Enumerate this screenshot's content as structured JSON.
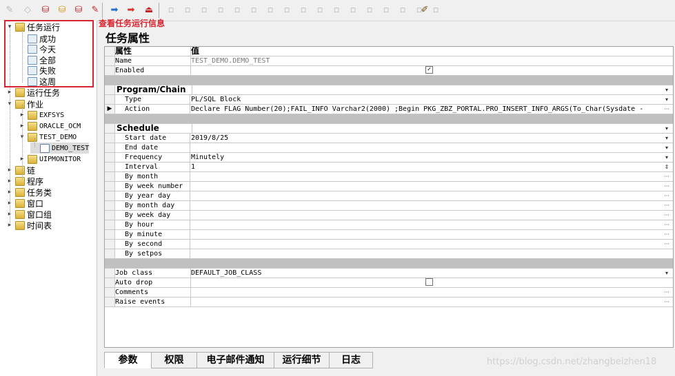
{
  "annotation": "查看任务运行信息",
  "panel_title": "任务属性",
  "tree": {
    "items": [
      {
        "label": "任务运行",
        "level": 0,
        "state": "open",
        "icon": "folder"
      },
      {
        "label": "成功",
        "level": 1,
        "state": "leaf",
        "icon": "page"
      },
      {
        "label": "今天",
        "level": 1,
        "state": "leaf",
        "icon": "page"
      },
      {
        "label": "全部",
        "level": 1,
        "state": "leaf",
        "icon": "page"
      },
      {
        "label": "失败",
        "level": 1,
        "state": "leaf",
        "icon": "page"
      },
      {
        "label": "这周",
        "level": 1,
        "state": "leaf",
        "icon": "page"
      },
      {
        "label": "运行任务",
        "level": 0,
        "state": "closed",
        "icon": "folder"
      },
      {
        "label": "作业",
        "level": 0,
        "state": "open",
        "icon": "folder"
      },
      {
        "label": "EXFSYS",
        "level": 1,
        "state": "closed",
        "icon": "folder"
      },
      {
        "label": "ORACLE_OCM",
        "level": 1,
        "state": "closed",
        "icon": "folder"
      },
      {
        "label": "TEST_DEMO",
        "level": 1,
        "state": "open",
        "icon": "folder"
      },
      {
        "label": "DEMO_TEST",
        "level": 2,
        "state": "leaf",
        "icon": "job",
        "selected": true
      },
      {
        "label": "UIPMONITOR",
        "level": 1,
        "state": "closed",
        "icon": "folder"
      },
      {
        "label": "链",
        "level": 0,
        "state": "closed",
        "icon": "folder"
      },
      {
        "label": "程序",
        "level": 0,
        "state": "closed",
        "icon": "folder"
      },
      {
        "label": "任务类",
        "level": 0,
        "state": "closed",
        "icon": "folder"
      },
      {
        "label": "窗口",
        "level": 0,
        "state": "closed",
        "icon": "folder"
      },
      {
        "label": "窗口组",
        "level": 0,
        "state": "closed",
        "icon": "folder"
      },
      {
        "label": "时间表",
        "level": 0,
        "state": "closed",
        "icon": "folder"
      }
    ]
  },
  "grid": {
    "col_property": "属性",
    "col_value": "值",
    "rows": [
      {
        "type": "row",
        "property": "Name",
        "value": "TEST_DEMO.DEMO_TEST",
        "value_gray": true
      },
      {
        "type": "row",
        "property": "Enabled",
        "checkbox": true,
        "checked": true
      },
      {
        "type": "group"
      },
      {
        "type": "section",
        "property": "Program/Chain",
        "button": "dropdown"
      },
      {
        "type": "row",
        "property": "Type",
        "value": "PL/SQL Block",
        "button": "dropdown",
        "indent": true
      },
      {
        "type": "row",
        "property": "Action",
        "value": "Declare  FLAG Number(20);FAIL_INFO   Varchar2(2000) ;Begin PKG_ZBZ_PORTAL.PRO_INSERT_INFO_ARGS(To_Char(Sysdate -",
        "button": "ellipsis",
        "indent": true,
        "current": true
      },
      {
        "type": "group"
      },
      {
        "type": "section",
        "property": "Schedule",
        "button": "dropdown"
      },
      {
        "type": "row",
        "property": "Start date",
        "value": "2019/8/25",
        "button": "dropdown",
        "indent": true
      },
      {
        "type": "row",
        "property": "End date",
        "value": "",
        "button": "dropdown",
        "indent": true
      },
      {
        "type": "row",
        "property": "Frequency",
        "value": "Minutely",
        "button": "dropdown",
        "indent": true
      },
      {
        "type": "row",
        "property": "Interval",
        "value": "1",
        "button": "spin",
        "indent": true
      },
      {
        "type": "row",
        "property": "By month",
        "value": "",
        "button": "ellipsis",
        "indent": true
      },
      {
        "type": "row",
        "property": "By week number",
        "value": "",
        "button": "ellipsis",
        "indent": true
      },
      {
        "type": "row",
        "property": "By year day",
        "value": "",
        "button": "ellipsis",
        "indent": true
      },
      {
        "type": "row",
        "property": "By month day",
        "value": "",
        "button": "ellipsis",
        "indent": true
      },
      {
        "type": "row",
        "property": "By week day",
        "value": "",
        "button": "ellipsis",
        "indent": true
      },
      {
        "type": "row",
        "property": "By hour",
        "value": "",
        "button": "ellipsis",
        "indent": true
      },
      {
        "type": "row",
        "property": "By minute",
        "value": "",
        "button": "ellipsis",
        "indent": true
      },
      {
        "type": "row",
        "property": "By second",
        "value": "",
        "button": "ellipsis",
        "indent": true
      },
      {
        "type": "row",
        "property": "By setpos",
        "value": "",
        "button": "",
        "indent": true
      },
      {
        "type": "group"
      },
      {
        "type": "row",
        "property": "Job class",
        "value": "DEFAULT_JOB_CLASS",
        "button": "dropdown"
      },
      {
        "type": "row",
        "property": "Auto drop",
        "checkbox": true,
        "checked": false
      },
      {
        "type": "row",
        "property": "Comments",
        "value": "",
        "button": "ellipsis"
      },
      {
        "type": "row",
        "property": "Raise events",
        "value": "",
        "button": "ellipsis"
      }
    ]
  },
  "tabs": [
    {
      "label": "参数",
      "active": true
    },
    {
      "label": "权限",
      "active": false
    },
    {
      "label": "电子邮件通知",
      "active": false
    },
    {
      "label": "运行细节",
      "active": false
    },
    {
      "label": "日志",
      "active": false
    }
  ],
  "watermark": "https://blog.csdn.net/zhangbeizhen18",
  "toolbar": {
    "buttons": [
      {
        "icon": "wand-icon",
        "enabled": false
      },
      {
        "icon": "eraser-icon",
        "enabled": false
      },
      {
        "icon": "db-red-icon",
        "enabled": true
      },
      {
        "icon": "db-yellow-icon",
        "enabled": true
      },
      {
        "icon": "db-export-icon",
        "enabled": true
      },
      {
        "icon": "db-edit-icon",
        "enabled": true
      },
      {
        "icon": "arrow-right-blue-icon",
        "enabled": true
      },
      {
        "icon": "arrow-right-red-icon",
        "enabled": true
      },
      {
        "icon": "disconnect-icon",
        "enabled": true
      },
      {
        "icon": "tool-1-icon",
        "enabled": false
      },
      {
        "icon": "tool-2-icon",
        "enabled": false
      },
      {
        "icon": "tool-3-icon",
        "enabled": false
      },
      {
        "icon": "tool-4-icon",
        "enabled": false
      },
      {
        "icon": "tool-5-icon",
        "enabled": false
      },
      {
        "icon": "tool-6-icon",
        "enabled": false
      },
      {
        "icon": "tool-7-icon",
        "enabled": false
      },
      {
        "icon": "tool-8-icon",
        "enabled": false
      },
      {
        "icon": "tool-9-icon",
        "enabled": false
      },
      {
        "icon": "tool-10-icon",
        "enabled": false
      },
      {
        "icon": "tool-11-icon",
        "enabled": false
      },
      {
        "icon": "tool-12-icon",
        "enabled": false
      },
      {
        "icon": "tool-13-icon",
        "enabled": false
      },
      {
        "icon": "tool-14-icon",
        "enabled": false
      },
      {
        "icon": "tool-15-icon",
        "enabled": false
      },
      {
        "icon": "tool-16-icon",
        "enabled": false
      },
      {
        "icon": "tool-17-icon",
        "enabled": false
      },
      {
        "icon": "brush-icon",
        "enabled": true
      }
    ]
  },
  "colors": {
    "annotation": "#d9232e",
    "group_bar": "#c0c0c0"
  }
}
